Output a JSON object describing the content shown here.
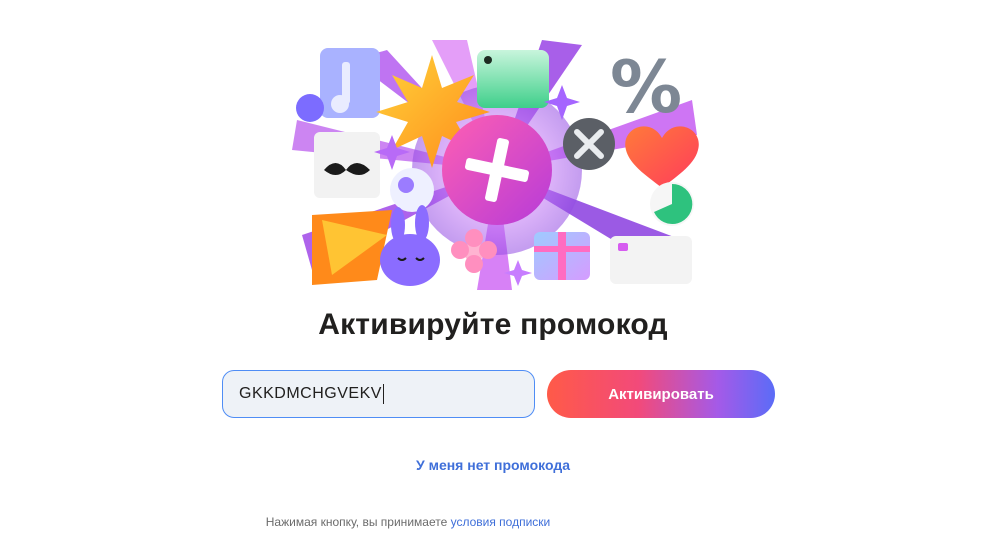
{
  "hero": {
    "image": "plus-subscription-collage-illustration"
  },
  "title": "Активируйте промокод",
  "promo": {
    "value": "GKKDMCHGVEKV",
    "activate_label": "Активировать",
    "no_promo_label": "У меня нет промокода"
  },
  "terms": {
    "text": "Нажимая кнопку, вы принимаете",
    "link_label": "условия подписки"
  },
  "colors": {
    "button_gradient": [
      "#ff5a48",
      "#f24a7a",
      "#a45ae8",
      "#5b6cf7"
    ],
    "link": "#3f6fd9",
    "input_border": "#4f8df5",
    "input_bg": "#eef2f7"
  }
}
